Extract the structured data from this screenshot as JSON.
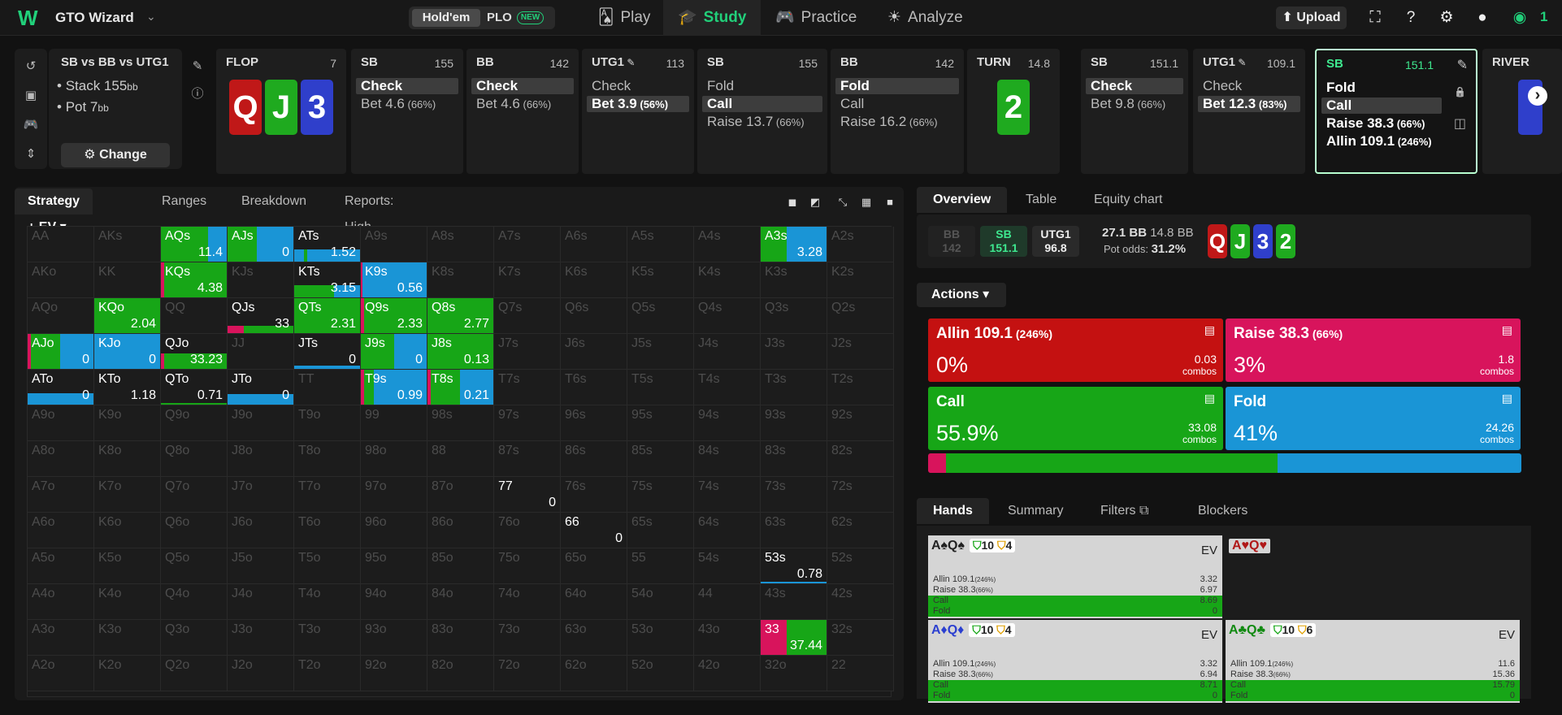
{
  "app": {
    "name": "GTO Wizard",
    "balance_icon": "wizard-coin-icon"
  },
  "games": {
    "holdem": "Hold'em",
    "plo": "PLO",
    "plo_badge": "NEW"
  },
  "nav": [
    {
      "label": "Play",
      "icon": "poker-cards-icon"
    },
    {
      "label": "Study",
      "icon": "graduation-cap-icon"
    },
    {
      "label": "Practice",
      "icon": "gamepad-icon"
    },
    {
      "label": "Analyze",
      "icon": "bulb-icon"
    }
  ],
  "toolbar": {
    "upload": "Upload"
  },
  "spot": {
    "title": "SB vs BB vs UTG1",
    "stack": "Stack 155",
    "stack_unit": "bb",
    "pot": "Pot 7",
    "pot_unit": "bb",
    "change": "Change"
  },
  "columns": [
    {
      "name": "FLOP",
      "num": "7",
      "kind": "board",
      "cards": [
        {
          "r": "Q",
          "c": "red"
        },
        {
          "r": "J",
          "c": "green"
        },
        {
          "r": "3",
          "c": "blue"
        }
      ]
    },
    {
      "name": "SB",
      "num": "155",
      "kind": "opts",
      "options": [
        {
          "t": "Check",
          "sel": true
        },
        {
          "t": "Bet 4.6",
          "s": "(66%)"
        }
      ]
    },
    {
      "name": "BB",
      "num": "142",
      "kind": "opts",
      "options": [
        {
          "t": "Check",
          "sel": true
        },
        {
          "t": "Bet 4.6",
          "s": "(66%)"
        }
      ]
    },
    {
      "name": "UTG1",
      "num": "113",
      "kind": "opts",
      "edit": true,
      "options": [
        {
          "t": "Check"
        },
        {
          "t": "Bet 3.9",
          "s": "(56%)",
          "sel": true
        }
      ]
    },
    {
      "name": "SB",
      "num": "155",
      "kind": "opts",
      "options": [
        {
          "t": "Fold"
        },
        {
          "t": "Call",
          "sel": true
        },
        {
          "t": "Raise 13.7",
          "s": "(66%)"
        }
      ]
    },
    {
      "name": "BB",
      "num": "142",
      "kind": "opts",
      "options": [
        {
          "t": "Fold",
          "sel": true
        },
        {
          "t": "Call"
        },
        {
          "t": "Raise 16.2",
          "s": "(66%)"
        }
      ]
    },
    {
      "name": "TURN",
      "num": "14.8",
      "kind": "board",
      "cards": [
        {
          "r": "2",
          "c": "green"
        }
      ]
    },
    {
      "name": "SB",
      "num": "151.1",
      "kind": "opts",
      "options": [
        {
          "t": "Check",
          "sel": true
        },
        {
          "t": "Bet 9.8",
          "s": "(66%)"
        }
      ]
    },
    {
      "name": "UTG1",
      "num": "109.1",
      "kind": "opts",
      "edit": true,
      "options": [
        {
          "t": "Check"
        },
        {
          "t": "Bet 12.3",
          "s": "(83%)",
          "sel": true
        }
      ]
    },
    {
      "name": "SB",
      "num": "151.1",
      "kind": "opts",
      "active": true,
      "options": [
        {
          "t": "Fold"
        },
        {
          "t": "Call",
          "sel": true
        },
        {
          "t": "Raise 38.3",
          "s": "(66%)"
        },
        {
          "t": "Allin 109.1",
          "s": "(246%)"
        }
      ]
    },
    {
      "name": "RIVER",
      "num": "",
      "kind": "river"
    }
  ],
  "strategy_tabs": [
    "Strategy + EV",
    "Ranges",
    "Breakdown",
    "Reports: High cards"
  ],
  "ranks": [
    "A",
    "K",
    "Q",
    "J",
    "T",
    "9",
    "8",
    "7",
    "6",
    "5",
    "4",
    "3",
    "2"
  ],
  "matrix_values": {
    "AQs": {
      "v": "11.4",
      "f": [
        [
          0,
          0
        ],
        [
          0.5,
          0
        ],
        [
          0.5,
          0
        ]
      ]
    },
    "AJs": {
      "v": "0"
    },
    "ATs": {
      "v": "1.52"
    },
    "A3s": {
      "v": "3.28"
    },
    "KQs": {
      "v": "4.38"
    },
    "KTs": {
      "v": "3.15"
    },
    "K9s": {
      "v": "0.56"
    },
    "KQo": {
      "v": "2.04"
    },
    "QJs": {
      "v": "33"
    },
    "QTs": {
      "v": "2.31"
    },
    "Q9s": {
      "v": "2.33"
    },
    "Q8s": {
      "v": "2.77"
    },
    "AJo": {
      "v": "0"
    },
    "KJo": {
      "v": "0"
    },
    "QJo": {
      "v": "33.23"
    },
    "JTs": {
      "v": "0"
    },
    "J9s": {
      "v": "0"
    },
    "J8s": {
      "v": "0.13"
    },
    "ATo": {
      "v": "0"
    },
    "KTo": {
      "v": "1.18"
    },
    "QTo": {
      "v": "0.71"
    },
    "JTo": {
      "v": "0"
    },
    "T9s": {
      "v": "0.99"
    },
    "T8s": {
      "v": "0.21"
    },
    "77": {
      "v": "0"
    },
    "66": {
      "v": "0"
    },
    "53s": {
      "v": "0.78"
    },
    "33": {
      "v": "37.44"
    }
  },
  "overview_tabs": [
    "Overview",
    "Table",
    "Equity chart"
  ],
  "players": [
    {
      "name": "BB",
      "stack": "142"
    },
    {
      "name": "SB",
      "stack": "151.1"
    },
    {
      "name": "UTG1",
      "stack": "96.8"
    }
  ],
  "pot": {
    "main": "27.1 BB",
    "side": "14.8 BB",
    "odds_label": "Pot odds:",
    "odds": "31.2%"
  },
  "board": [
    {
      "r": "Q",
      "c": "red"
    },
    {
      "r": "J",
      "c": "green"
    },
    {
      "r": "3",
      "c": "blue"
    },
    {
      "r": "2",
      "c": "green"
    }
  ],
  "actions_label": "Actions",
  "actions": [
    {
      "name": "Allin 109.1",
      "sub": "(246%)",
      "pct": "0%",
      "combos": "0.03",
      "color": "#c41111"
    },
    {
      "name": "Raise 38.3",
      "sub": "(66%)",
      "pct": "3%",
      "combos": "1.8",
      "color": "#d8145c"
    },
    {
      "name": "Call",
      "sub": "",
      "pct": "55.9%",
      "combos": "33.08",
      "color": "#17a617"
    },
    {
      "name": "Fold",
      "sub": "",
      "pct": "41%",
      "combos": "24.26",
      "color": "#1a95d6"
    }
  ],
  "combos_label": "combos",
  "strategy_bar": [
    {
      "c": "#d8145c",
      "w": 3
    },
    {
      "c": "#17a617",
      "w": 55.9
    },
    {
      "c": "#1a95d6",
      "w": 41.1
    }
  ],
  "hands_tabs": [
    "Hands",
    "Summary",
    "Filters",
    "Blockers"
  ],
  "hand_cards": [
    {
      "hand": "A♠Q♠",
      "b1": "10",
      "b2": "4",
      "ev": "EV",
      "rows": [
        [
          "Allin 109.1",
          "(246%)",
          "3.32"
        ],
        [
          "Raise 38.3",
          "(66%)",
          "6.97"
        ],
        [
          "Call",
          "",
          "8.69"
        ],
        [
          "Fold",
          "",
          "0"
        ]
      ]
    },
    {
      "hand": "A♥Q♥",
      "ev": "",
      "rows": []
    },
    {
      "hand": "A♦Q♦",
      "b1": "10",
      "b2": "4",
      "ev": "EV",
      "rows": [
        [
          "Allin 109.1",
          "(246%)",
          "3.32"
        ],
        [
          "Raise 38.3",
          "(66%)",
          "6.94"
        ],
        [
          "Call",
          "",
          "8.71"
        ],
        [
          "Fold",
          "",
          "0"
        ]
      ]
    },
    {
      "hand": "A♣Q♣",
      "b1": "10",
      "b2": "6",
      "ev": "EV",
      "rows": [
        [
          "Allin 109.1",
          "(246%)",
          "11.6"
        ],
        [
          "Raise 38.3",
          "(66%)",
          "15.36"
        ],
        [
          "Call",
          "",
          "15.79"
        ],
        [
          "Fold",
          "",
          "0"
        ]
      ]
    }
  ]
}
